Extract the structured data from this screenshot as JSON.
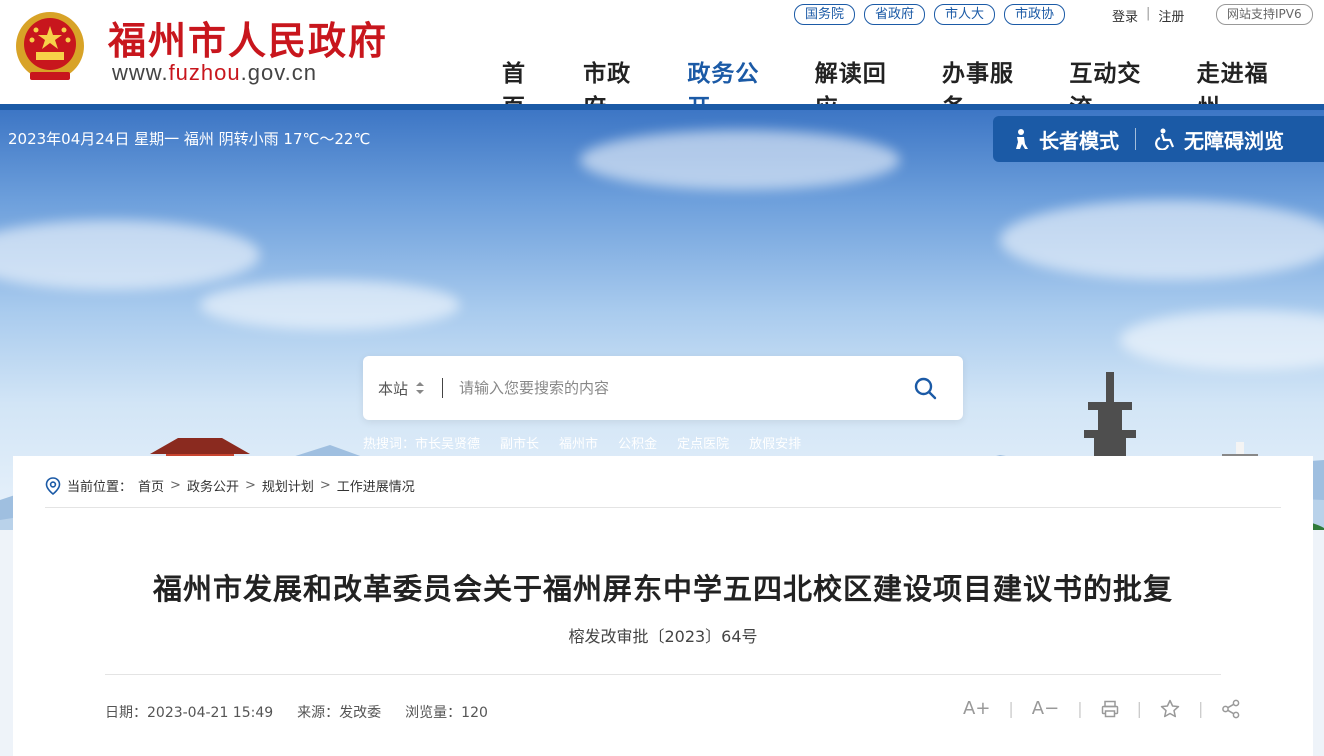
{
  "header": {
    "site_name": "福州市人民政府",
    "domain_prefix": "www.",
    "domain_main": "fuzhou",
    "domain_suffix": ".gov.cn",
    "top_links": [
      "国务院",
      "省政府",
      "市人大",
      "市政协"
    ],
    "login": "登录",
    "register": "注册",
    "ipv6": "网站支持IPV6",
    "nav": [
      {
        "label": "首页"
      },
      {
        "label": "市政府"
      },
      {
        "label": "政务公开",
        "active": true
      },
      {
        "label": "解读回应"
      },
      {
        "label": "办事服务"
      },
      {
        "label": "互动交流"
      },
      {
        "label": "走进福州"
      }
    ],
    "accent_color": "#1b5aa6",
    "brand_color": "#c8161d"
  },
  "banner": {
    "date_weather": "2023年04月24日 星期一  福州 阴转小雨 17℃～22℃",
    "elder_mode": "长者模式",
    "accessibility": "无障碍浏览",
    "search": {
      "scope": "本站",
      "placeholder": "请输入您要搜索的内容"
    },
    "hot_label": "热搜词：",
    "hot_words": [
      "市长吴贤德",
      "副市长",
      "福州市",
      "公积金",
      "定点医院",
      "放假安排"
    ]
  },
  "article": {
    "breadcrumb_label": "当前位置：",
    "breadcrumb": [
      "首页",
      "政务公开",
      "规划计划",
      "工作进展情况"
    ],
    "title": "福州市发展和改革委员会关于福州屏东中学五四北校区建设项目建议书的批复",
    "doc_number": "榕发改审批〔2023〕64号",
    "date": "日期：2023-04-21 15:49",
    "source": "来源：发改委",
    "views": "浏览量：120",
    "tools": {
      "font_larger": "A+",
      "font_smaller": "A−"
    }
  }
}
